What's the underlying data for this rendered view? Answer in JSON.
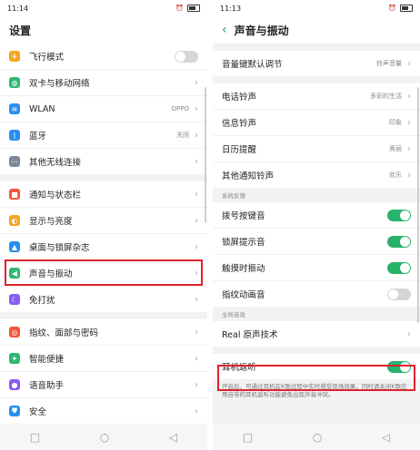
{
  "left": {
    "status": {
      "time": "11:14",
      "signal": "▂▄▆",
      "wifi": "≋"
    },
    "title": "设置",
    "group1": [
      {
        "label": "飞行模式",
        "icon": "airplane-icon",
        "color": "#f4a623",
        "glyph": "✈",
        "toggle": false
      },
      {
        "label": "双卡与移动网络",
        "icon": "globe-icon",
        "color": "#2eb872",
        "glyph": "◍",
        "chevron": "›"
      },
      {
        "label": "WLAN",
        "icon": "wifi-icon",
        "color": "#2a8ef0",
        "glyph": "≋",
        "value": "OPPO",
        "chevron": "›"
      },
      {
        "label": "蓝牙",
        "icon": "bluetooth-icon",
        "color": "#2a8ef0",
        "glyph": "ᛒ",
        "value": "关闭",
        "chevron": "›"
      },
      {
        "label": "其他无线连接",
        "icon": "more-connections-icon",
        "color": "#7d8a99",
        "glyph": "⋯",
        "chevron": "›"
      }
    ],
    "group2": [
      {
        "label": "通知与状态栏",
        "icon": "notification-icon",
        "color": "#f2553a",
        "glyph": "■",
        "chevron": "›"
      },
      {
        "label": "显示与亮度",
        "icon": "brightness-icon",
        "color": "#f4a623",
        "glyph": "◐",
        "chevron": "›"
      },
      {
        "label": "桌面与锁屏杂志",
        "icon": "wallpaper-icon",
        "color": "#2a8ef0",
        "glyph": "▲",
        "chevron": "›"
      },
      {
        "label": "声音与振动",
        "icon": "sound-icon",
        "color": "#2eb872",
        "glyph": "◀",
        "chevron": "›"
      },
      {
        "label": "免打扰",
        "icon": "moon-icon",
        "color": "#8a5cf5",
        "glyph": "☾",
        "chevron": "›"
      }
    ],
    "group3": [
      {
        "label": "指纹、面部与密码",
        "icon": "fingerprint-icon",
        "color": "#f2553a",
        "glyph": "◎",
        "chevron": "›"
      },
      {
        "label": "智能便捷",
        "icon": "smart-icon",
        "color": "#2eb872",
        "glyph": "✦",
        "chevron": "›"
      },
      {
        "label": "语音助手",
        "icon": "mic-icon",
        "color": "#8a5cf5",
        "glyph": "●",
        "chevron": "›"
      },
      {
        "label": "安全",
        "icon": "shield-icon",
        "color": "#2a8ef0",
        "glyph": "⛊",
        "chevron": "›"
      }
    ],
    "nav": {
      "recent": "□",
      "home": "○",
      "back": "◁"
    }
  },
  "right": {
    "status": {
      "time": "11:13",
      "signal": "▂▄▆",
      "wifi": "≋"
    },
    "title": "声音与振动",
    "back": "‹",
    "group1": [
      {
        "label": "音量键默认调节",
        "value": "铃声音量",
        "chevron": "›"
      }
    ],
    "group2": [
      {
        "label": "电话铃声",
        "value": "多彩的生活",
        "chevron": "›"
      },
      {
        "label": "信息铃声",
        "value": "印象",
        "chevron": "›"
      },
      {
        "label": "日历提醒",
        "value": "奥丽",
        "chevron": "›"
      },
      {
        "label": "其他通知铃声",
        "value": "欢乐",
        "chevron": "›"
      }
    ],
    "section_feedback": "系统反馈",
    "group3": [
      {
        "label": "拨号按键音",
        "toggle": true
      },
      {
        "label": "锁屏提示音",
        "toggle": true
      },
      {
        "label": "触摸时振动",
        "toggle": true
      },
      {
        "label": "指纹动画音",
        "toggle": false
      }
    ],
    "section_global": "全局音效",
    "group4": [
      {
        "label": "Real 原声技术",
        "chevron": "›"
      }
    ],
    "group5": [
      {
        "label": "耳机返听",
        "toggle": true
      }
    ],
    "description": "开启后，可通过耳机在K歌过程中实时感受现场效果，同时请关闭K歌应用自带的耳机返听功能避免出现声音冲突。",
    "nav": {
      "recent": "□",
      "home": "○",
      "back": "◁",
      "extra": "8"
    }
  },
  "colors": {
    "accent": "#28b36b",
    "highlight": "#e0222b"
  }
}
